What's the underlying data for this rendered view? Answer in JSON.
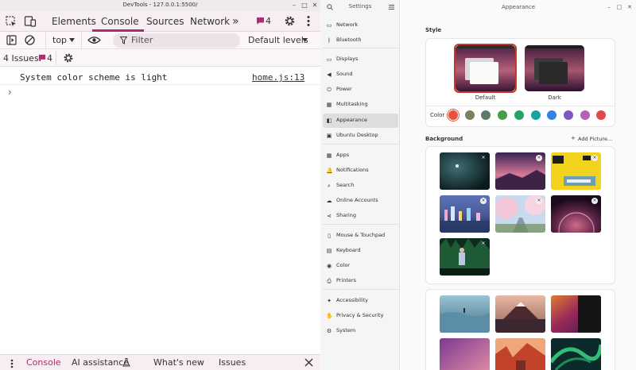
{
  "devtools": {
    "window_title": "DevTools - 127.0.0.1:5500/",
    "tabs": [
      "Elements",
      "Console",
      "Sources",
      "Network"
    ],
    "active_tab": "Console",
    "more_tabs_glyph": "»",
    "issues_badge_count": "4",
    "toolbar": {
      "context": "top",
      "filter_placeholder": "Filter",
      "levels": "Default levels"
    },
    "issues_bar": {
      "label": "4 Issues:",
      "count": "4"
    },
    "console_messages": [
      {
        "text": "System color scheme is light",
        "source": "home.js:13"
      }
    ],
    "prompt_glyph": "›",
    "drawer_tabs": [
      "Console",
      "AI assistance",
      "What's new",
      "Issues"
    ],
    "accent": "#b02b6d"
  },
  "settings": {
    "title": "Settings",
    "items": [
      {
        "label": "Network",
        "icon": "network-icon",
        "glyph": "▭"
      },
      {
        "label": "Bluetooth",
        "icon": "bluetooth-icon",
        "glyph": "ᛒ"
      },
      {
        "label": "Displays",
        "icon": "display-icon",
        "glyph": "▭"
      },
      {
        "label": "Sound",
        "icon": "sound-icon",
        "glyph": "◀"
      },
      {
        "label": "Power",
        "icon": "power-icon",
        "glyph": "⏻"
      },
      {
        "label": "Multitasking",
        "icon": "multitasking-icon",
        "glyph": "▦"
      },
      {
        "label": "Appearance",
        "icon": "appearance-icon",
        "glyph": "◧"
      },
      {
        "label": "Ubuntu Desktop",
        "icon": "ubuntu-desktop-icon",
        "glyph": "▣"
      },
      {
        "label": "Apps",
        "icon": "apps-icon",
        "glyph": "▦"
      },
      {
        "label": "Notifications",
        "icon": "notifications-icon",
        "glyph": "🔔"
      },
      {
        "label": "Search",
        "icon": "search-icon",
        "glyph": "⌕"
      },
      {
        "label": "Online Accounts",
        "icon": "online-accounts-icon",
        "glyph": "☁"
      },
      {
        "label": "Sharing",
        "icon": "sharing-icon",
        "glyph": "⋖"
      },
      {
        "label": "Mouse & Touchpad",
        "icon": "mouse-icon",
        "glyph": "▯"
      },
      {
        "label": "Keyboard",
        "icon": "keyboard-icon",
        "glyph": "▤"
      },
      {
        "label": "Color",
        "icon": "color-icon",
        "glyph": "◉"
      },
      {
        "label": "Printers",
        "icon": "printer-icon",
        "glyph": "⎙"
      },
      {
        "label": "Accessibility",
        "icon": "accessibility-icon",
        "glyph": "✦"
      },
      {
        "label": "Privacy & Security",
        "icon": "privacy-icon",
        "glyph": "✋"
      },
      {
        "label": "System",
        "icon": "system-icon",
        "glyph": "⚙"
      }
    ],
    "selected": "Appearance"
  },
  "appearance": {
    "title": "Appearance",
    "style_label": "Style",
    "style_options": [
      "Default",
      "Dark"
    ],
    "selected_style": "Default",
    "color_label": "Color",
    "accent_colors": [
      "#e6533c",
      "#798160",
      "#5d7a66",
      "#43a047",
      "#26a269",
      "#17a2a6",
      "#3584e4",
      "#7e57c2",
      "#b561b7",
      "#e0484e"
    ],
    "selected_accent": "#e6533c",
    "background_label": "Background",
    "add_picture_label": "Add Picture…"
  }
}
